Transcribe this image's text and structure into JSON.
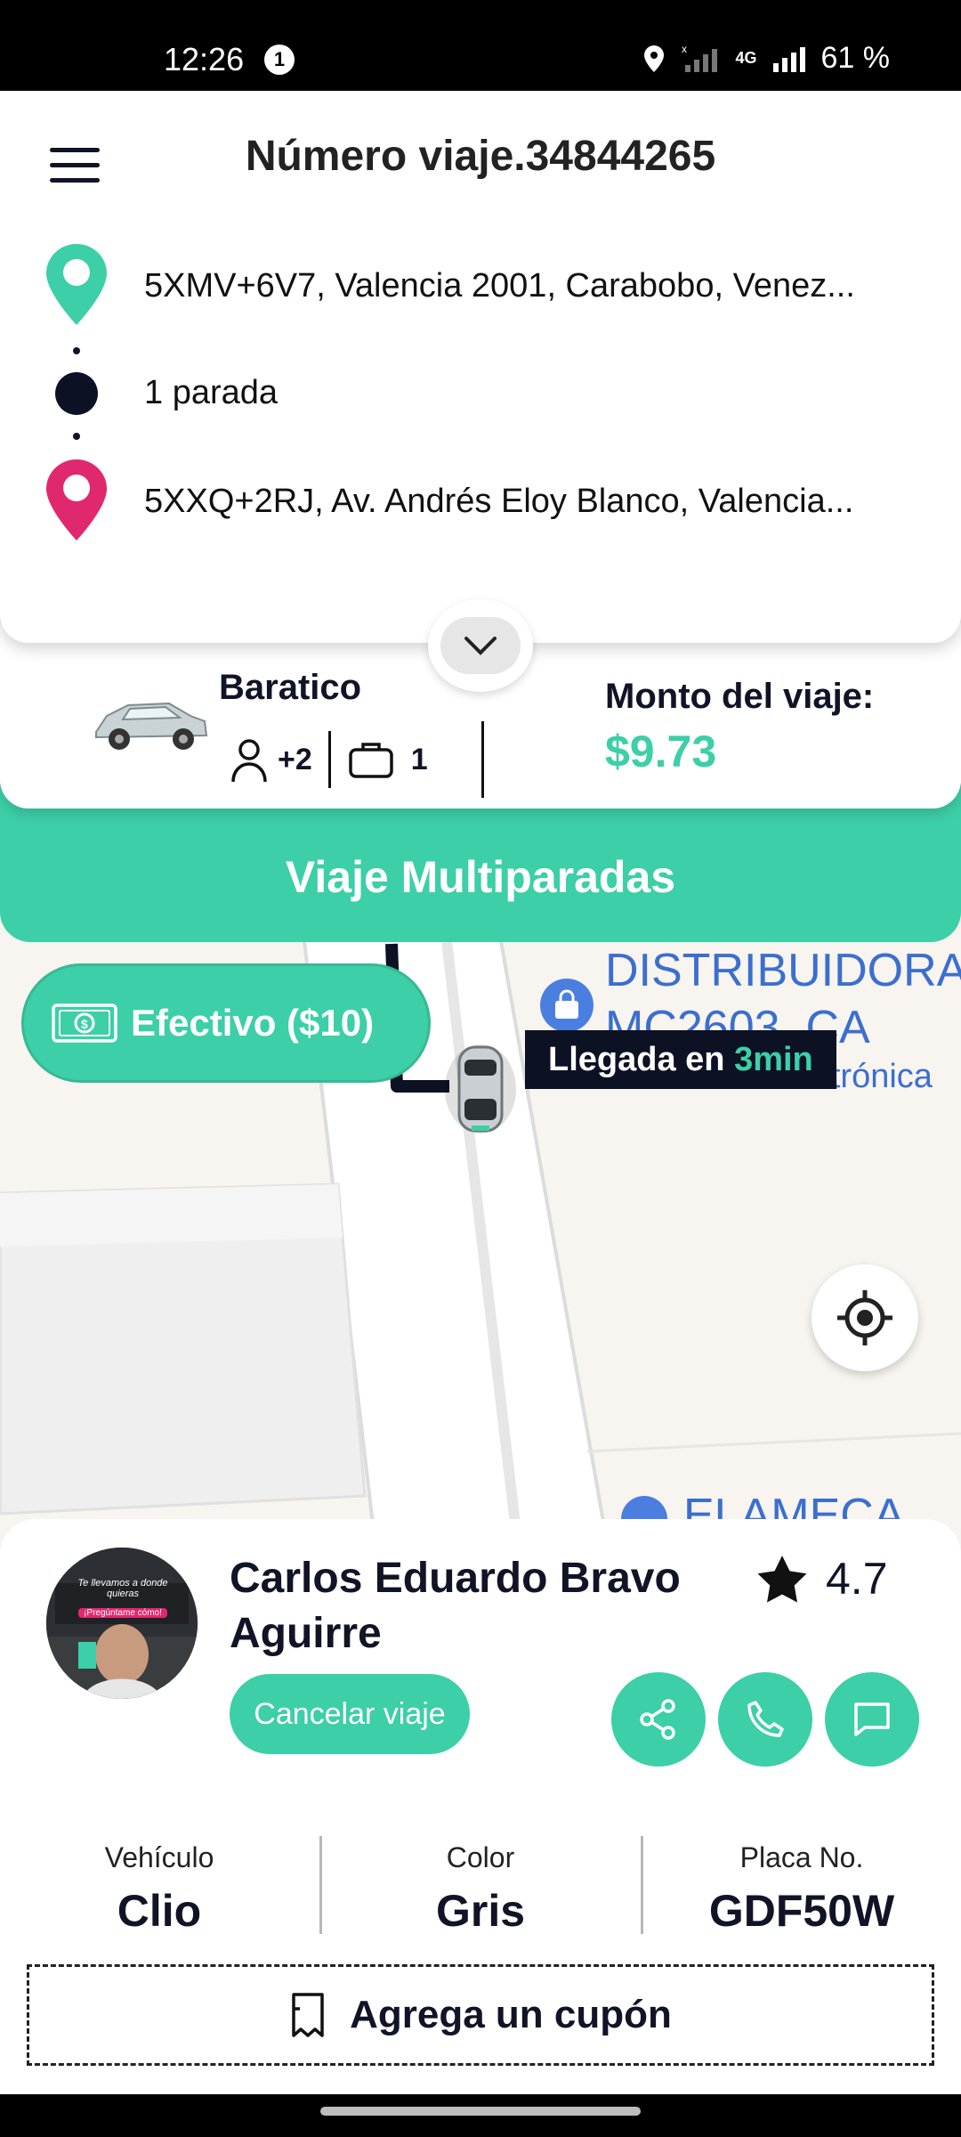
{
  "status": {
    "time": "12:26",
    "notification_count": "1",
    "battery": "61 %",
    "network": "4G"
  },
  "header": {
    "trip_title": "Número viaje.34844265"
  },
  "route": {
    "origin": "5XMV+6V7, Valencia 2001, Carabobo, Venez...",
    "stops": "1 parada",
    "destination": "5XXQ+2RJ, Av. Andrés Eloy Blanco, Valencia..."
  },
  "vehicle_summary": {
    "category": "Baratico",
    "passengers": "+2",
    "luggage": "1",
    "price_label": "Monto del viaje:",
    "price": "$9.73"
  },
  "trip_type": "Viaje Multiparadas",
  "payment": {
    "label": "Efectivo ($10)"
  },
  "eta": {
    "prefix": "Llegada en ",
    "value": "3min"
  },
  "map_labels": {
    "business_1_line1": "DISTRIBUIDORA",
    "business_1_line2": "MC2603, CA",
    "business_1_sub": "Tienda de electrónica",
    "business_2": "ELAMECA"
  },
  "driver": {
    "name": "Carlos Eduardo Bravo Aguirre",
    "rating": "4.7",
    "cancel_label": "Cancelar viaje",
    "avatar_text_1": "Te llevamos a donde quieras",
    "avatar_text_2": "¡Pregúntame cómo!"
  },
  "vehicle_info": {
    "vehicle_label": "Vehículo",
    "vehicle_value": "Clio",
    "color_label": "Color",
    "color_value": "Gris",
    "plate_label": "Placa No.",
    "plate_value": "GDF50W"
  },
  "coupon": {
    "label": "Agrega un cupón"
  },
  "colors": {
    "accent": "#3ccfa8",
    "origin_pin": "#3ccfa8",
    "destination_pin": "#e0286e",
    "dark": "#0d1124"
  }
}
